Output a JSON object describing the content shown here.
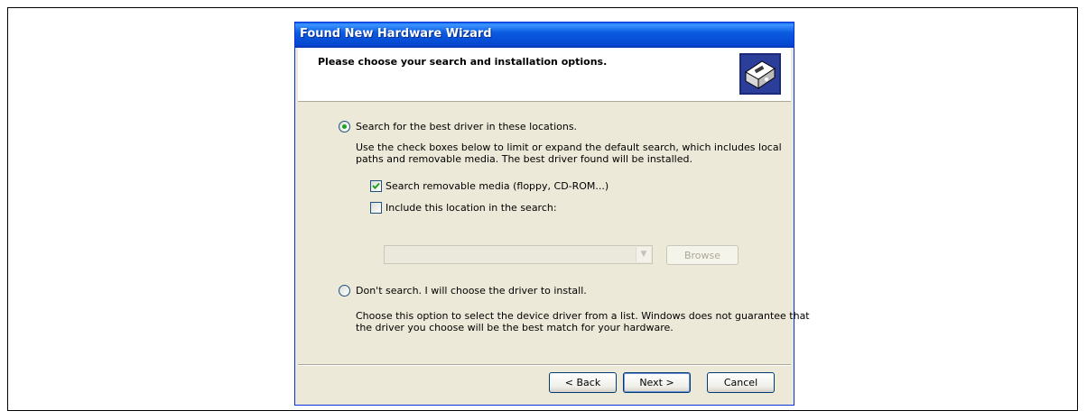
{
  "window": {
    "title": "Found New Hardware Wizard"
  },
  "header": {
    "title": "Please choose your search and installation options.",
    "icon": "hardware-wizard-icon"
  },
  "options": {
    "search": {
      "label": "Search for the best driver in these locations.",
      "selected": true,
      "description_line1": "Use the check boxes below to limit or expand the default search, which includes local",
      "description_line2": "paths and removable media. The best driver found will be installed.",
      "removable_media": {
        "label": "Search removable media (floppy, CD-ROM...)",
        "checked": true
      },
      "include_location": {
        "label": "Include this location in the search:",
        "checked": false
      },
      "location_value": "",
      "browse_label": "Browse"
    },
    "dont_search": {
      "label": "Don't search. I will choose the driver to install.",
      "selected": false,
      "description_line1": "Choose this option to select the device driver from a list.  Windows does not guarantee that",
      "description_line2": "the driver you choose will be the best match for your hardware."
    }
  },
  "buttons": {
    "back": "< Back",
    "next": "Next >",
    "cancel": "Cancel"
  },
  "colors": {
    "titlebar": "#0a5be0",
    "face": "#ece9d8",
    "accent_check": "#21a121"
  }
}
